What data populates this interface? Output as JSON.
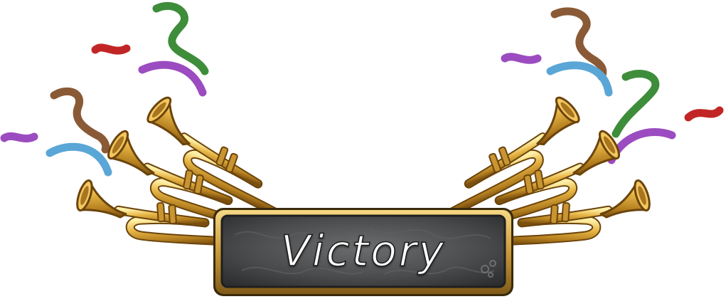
{
  "banner": {
    "title": "Victory"
  },
  "colors": {
    "brass": "#d9a83a",
    "brass_dark": "#8a5d12",
    "brass_light": "#fff0a8",
    "plaque": "#4a4b4c",
    "plaque_frame": "#c99a3a",
    "confetti_red": "#c22525",
    "confetti_green": "#3e8d3a",
    "confetti_purple": "#9b4cc0",
    "confetti_brown": "#8a5a36",
    "confetti_blue": "#5aa6d6"
  },
  "icons": {
    "trumpet": "trumpet-icon",
    "confetti": "confetti-icon"
  }
}
